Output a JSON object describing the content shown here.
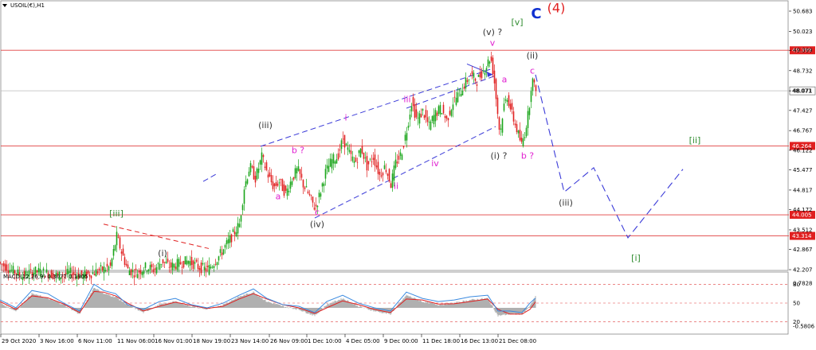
{
  "chart_data": {
    "type": "candlestick",
    "symbol_label": "USOIL(€),H1",
    "price_axis": {
      "ticks": [
        "50.683",
        "50.023",
        "49.399",
        "48.732",
        "48.071",
        "47.427",
        "46.767",
        "46.122",
        "45.477",
        "44.817",
        "44.172",
        "43.512",
        "42.867",
        "42.207"
      ],
      "ylim": [
        42.207,
        50.683
      ]
    },
    "horizontal_levels": [
      {
        "label": "49.399",
        "value": 49.399
      },
      {
        "label": "48.071",
        "value": 48.071,
        "style": "current"
      },
      {
        "label": "46.264",
        "value": 46.264
      },
      {
        "label": "44.005",
        "value": 44.005
      },
      {
        "label": "43.314",
        "value": 43.314
      }
    ],
    "price_path": [
      [
        0,
        42.45
      ],
      [
        15,
        42.2
      ],
      [
        30,
        42.0
      ],
      [
        45,
        42.15
      ],
      [
        60,
        42.1
      ],
      [
        75,
        42.0
      ],
      [
        90,
        42.1
      ],
      [
        105,
        42.0
      ],
      [
        118,
        42.1
      ],
      [
        128,
        42.2
      ],
      [
        140,
        42.3
      ],
      [
        148,
        43.3
      ],
      [
        155,
        42.7
      ],
      [
        162,
        42.2
      ],
      [
        172,
        42.1
      ],
      [
        185,
        42.3
      ],
      [
        195,
        42.2
      ],
      [
        205,
        42.5
      ],
      [
        215,
        42.3
      ],
      [
        225,
        42.4
      ],
      [
        238,
        42.5
      ],
      [
        250,
        42.3
      ],
      [
        262,
        42.2
      ],
      [
        275,
        42.6
      ],
      [
        285,
        43.0
      ],
      [
        295,
        43.4
      ],
      [
        302,
        43.7
      ],
      [
        308,
        44.9
      ],
      [
        315,
        45.6
      ],
      [
        322,
        45.2
      ],
      [
        330,
        45.9
      ],
      [
        338,
        45.3
      ],
      [
        345,
        44.9
      ],
      [
        352,
        45.1
      ],
      [
        360,
        44.7
      ],
      [
        368,
        45.2
      ],
      [
        375,
        45.5
      ],
      [
        382,
        45.0
      ],
      [
        390,
        44.6
      ],
      [
        397,
        44.2
      ],
      [
        403,
        44.7
      ],
      [
        410,
        45.4
      ],
      [
        418,
        45.8
      ],
      [
        425,
        45.9
      ],
      [
        432,
        46.5
      ],
      [
        440,
        46.0
      ],
      [
        447,
        45.7
      ],
      [
        455,
        46.2
      ],
      [
        462,
        45.6
      ],
      [
        470,
        45.9
      ],
      [
        478,
        45.3
      ],
      [
        485,
        45.6
      ],
      [
        492,
        45.0
      ],
      [
        498,
        45.7
      ],
      [
        505,
        46.0
      ],
      [
        512,
        46.8
      ],
      [
        518,
        47.7
      ],
      [
        525,
        47.1
      ],
      [
        532,
        47.4
      ],
      [
        540,
        46.9
      ],
      [
        547,
        47.3
      ],
      [
        555,
        47.5
      ],
      [
        562,
        47.1
      ],
      [
        570,
        47.7
      ],
      [
        578,
        48.0
      ],
      [
        585,
        48.3
      ],
      [
        592,
        48.6
      ],
      [
        600,
        48.4
      ],
      [
        607,
        48.7
      ],
      [
        612,
        48.9
      ],
      [
        617,
        49.2
      ],
      [
        621,
        48.6
      ],
      [
        625,
        47.6
      ],
      [
        629,
        46.6
      ],
      [
        633,
        47.5
      ],
      [
        638,
        47.9
      ],
      [
        644,
        47.3
      ],
      [
        650,
        46.8
      ],
      [
        656,
        46.3
      ],
      [
        660,
        46.7
      ],
      [
        665,
        47.4
      ],
      [
        669,
        48.5
      ],
      [
        672,
        48.2
      ]
    ],
    "elliptic": {
      "wave_labels": [
        {
          "text": "[iii]",
          "color": "#2e8b2e",
          "at": [
            146,
            43.95
          ]
        },
        {
          "text": "(i)",
          "color": "#333333",
          "at": [
            204,
            42.65
          ]
        },
        {
          "text": "(iii)",
          "color": "#333333",
          "at": [
            333,
            46.85
          ]
        },
        {
          "text": "b ?",
          "color": "#e020d0",
          "at": [
            374,
            46.03
          ]
        },
        {
          "text": "a",
          "color": "#e020d0",
          "at": [
            349,
            44.52
          ]
        },
        {
          "text": "c",
          "color": "#e020d0",
          "at": [
            398,
            44.0
          ]
        },
        {
          "text": "(iv)",
          "color": "#333333",
          "at": [
            398,
            43.6
          ]
        },
        {
          "text": "i",
          "color": "#e020d0",
          "at": [
            434,
            47.1
          ]
        },
        {
          "text": "ii",
          "color": "#e020d0",
          "at": [
            497,
            44.85
          ]
        },
        {
          "text": "iii",
          "color": "#e020d0",
          "at": [
            511,
            47.7
          ]
        },
        {
          "text": "iv",
          "color": "#e020d0",
          "at": [
            546,
            45.6
          ]
        },
        {
          "text": "v",
          "color": "#e020d0",
          "at": [
            618,
            49.55
          ]
        },
        {
          "text": "(v) ?",
          "color": "#333333",
          "at": [
            618,
            49.9
          ]
        },
        {
          "text": "[v]",
          "color": "#2e8b2e",
          "at": [
            649,
            50.23
          ]
        },
        {
          "text": "C",
          "color": "#1030d0",
          "at": [
            673,
            50.45
          ]
        },
        {
          "text": "(4)",
          "color": "#e02020",
          "at": [
            698,
            50.65
          ]
        },
        {
          "text": "(ii)",
          "color": "#333333",
          "at": [
            668,
            49.13
          ]
        },
        {
          "text": "c",
          "color": "#e020d0",
          "at": [
            668,
            48.63
          ]
        },
        {
          "text": "a",
          "color": "#e020d0",
          "at": [
            633,
            48.35
          ]
        },
        {
          "text": "(i) ?",
          "color": "#333333",
          "at": [
            626,
            45.85
          ]
        },
        {
          "text": "b ?",
          "color": "#e020d0",
          "at": [
            662,
            45.85
          ]
        },
        {
          "text": "(iii)",
          "color": "#333333",
          "at": [
            710,
            44.3
          ]
        },
        {
          "text": "[ii]",
          "color": "#2e8b2e",
          "at": [
            872,
            46.35
          ]
        },
        {
          "text": "[i]",
          "color": "#2e8b2e",
          "at": [
            798,
            42.5
          ]
        }
      ],
      "projection_path": [
        [
          672,
          48.6
        ],
        [
          708,
          44.75
        ],
        [
          745,
          45.55
        ],
        [
          788,
          43.25
        ],
        [
          857,
          45.5
        ]
      ],
      "channel_lines": [
        [
          [
            327,
            46.25
          ],
          [
            618,
            48.8
          ]
        ],
        [
          [
            395,
            43.9
          ],
          [
            622,
            46.9
          ]
        ],
        [
          [
            510,
            47.5
          ],
          [
            620,
            48.55
          ]
        ],
        [
          [
            255,
            45.1
          ],
          [
            272,
            45.35
          ]
        ]
      ],
      "red_dashed_line": [
        [
          130,
          43.7
        ],
        [
          262,
          42.9
        ]
      ],
      "small_arrow": [
        [
          586,
          48.95
        ],
        [
          618,
          48.6
        ]
      ]
    },
    "macd": {
      "label": "MACD(12,26,9) 0.3077 0.1905",
      "ticks": [
        "0.7828",
        "80",
        "50",
        "20",
        "-0.5806"
      ],
      "levels": [
        80,
        50,
        20
      ],
      "columns": [
        [
          0,
          0.15
        ],
        [
          20,
          -0.1
        ],
        [
          40,
          0.45
        ],
        [
          60,
          0.3
        ],
        [
          80,
          0.1
        ],
        [
          100,
          -0.2
        ],
        [
          118,
          0.65
        ],
        [
          130,
          0.45
        ],
        [
          145,
          0.35
        ],
        [
          160,
          0.1
        ],
        [
          180,
          -0.15
        ],
        [
          200,
          0.1
        ],
        [
          220,
          0.2
        ],
        [
          240,
          0.05
        ],
        [
          260,
          -0.05
        ],
        [
          280,
          0.1
        ],
        [
          300,
          0.35
        ],
        [
          318,
          0.5
        ],
        [
          335,
          0.2
        ],
        [
          355,
          0.05
        ],
        [
          375,
          -0.05
        ],
        [
          395,
          -0.25
        ],
        [
          410,
          0.1
        ],
        [
          430,
          0.3
        ],
        [
          450,
          0.05
        ],
        [
          470,
          -0.1
        ],
        [
          490,
          -0.2
        ],
        [
          510,
          0.4
        ],
        [
          530,
          0.2
        ],
        [
          550,
          0.1
        ],
        [
          570,
          0.15
        ],
        [
          590,
          0.25
        ],
        [
          612,
          0.3
        ],
        [
          625,
          -0.25
        ],
        [
          640,
          -0.2
        ],
        [
          655,
          -0.2
        ],
        [
          665,
          0.05
        ],
        [
          672,
          0.35
        ]
      ],
      "signal": [
        [
          0,
          0.2
        ],
        [
          20,
          -0.05
        ],
        [
          40,
          0.38
        ],
        [
          60,
          0.32
        ],
        [
          80,
          0.12
        ],
        [
          100,
          -0.15
        ],
        [
          118,
          0.52
        ],
        [
          130,
          0.5
        ],
        [
          145,
          0.38
        ],
        [
          160,
          0.15
        ],
        [
          180,
          -0.1
        ],
        [
          200,
          0.05
        ],
        [
          220,
          0.18
        ],
        [
          240,
          0.08
        ],
        [
          260,
          -0.02
        ],
        [
          280,
          0.05
        ],
        [
          300,
          0.28
        ],
        [
          318,
          0.45
        ],
        [
          335,
          0.28
        ],
        [
          355,
          0.1
        ],
        [
          375,
          0.0
        ],
        [
          395,
          -0.18
        ],
        [
          410,
          0.0
        ],
        [
          430,
          0.22
        ],
        [
          450,
          0.1
        ],
        [
          470,
          -0.05
        ],
        [
          490,
          -0.15
        ],
        [
          510,
          0.28
        ],
        [
          530,
          0.25
        ],
        [
          550,
          0.12
        ],
        [
          570,
          0.13
        ],
        [
          590,
          0.2
        ],
        [
          612,
          0.28
        ],
        [
          625,
          -0.05
        ],
        [
          640,
          -0.2
        ],
        [
          655,
          -0.2
        ],
        [
          665,
          -0.05
        ],
        [
          672,
          0.19
        ]
      ],
      "line": [
        [
          0,
          0.25
        ],
        [
          20,
          0.0
        ],
        [
          40,
          0.55
        ],
        [
          60,
          0.45
        ],
        [
          80,
          0.15
        ],
        [
          100,
          -0.1
        ],
        [
          118,
          0.75
        ],
        [
          130,
          0.55
        ],
        [
          145,
          0.45
        ],
        [
          160,
          0.1
        ],
        [
          180,
          -0.05
        ],
        [
          200,
          0.2
        ],
        [
          220,
          0.3
        ],
        [
          240,
          0.1
        ],
        [
          260,
          0.0
        ],
        [
          280,
          0.15
        ],
        [
          300,
          0.4
        ],
        [
          318,
          0.6
        ],
        [
          335,
          0.3
        ],
        [
          355,
          0.1
        ],
        [
          375,
          0.05
        ],
        [
          395,
          -0.15
        ],
        [
          410,
          0.2
        ],
        [
          430,
          0.4
        ],
        [
          450,
          0.15
        ],
        [
          470,
          0.0
        ],
        [
          490,
          -0.1
        ],
        [
          510,
          0.5
        ],
        [
          530,
          0.3
        ],
        [
          550,
          0.2
        ],
        [
          570,
          0.25
        ],
        [
          590,
          0.35
        ],
        [
          612,
          0.4
        ],
        [
          625,
          -0.1
        ],
        [
          640,
          -0.1
        ],
        [
          655,
          -0.15
        ],
        [
          665,
          0.15
        ],
        [
          672,
          0.31
        ]
      ]
    },
    "time_axis": [
      "29 Oct 2020",
      "3 Nov 16:00",
      "6 Nov 11:00",
      "11 Nov 06:00",
      "16 Nov 01:00",
      "18 Nov 19:00",
      "23 Nov 14:00",
      "26 Nov 09:00",
      "1 Dec 10:00",
      "4 Dec 05:00",
      "9 Dec 00:00",
      "11 Dec 18:00",
      "16 Dec 13:00",
      "21 Dec 08:00"
    ],
    "colors": {
      "bull": "#1aa51a",
      "bear": "#e02020",
      "level": "#e04040",
      "projection": "#3a3ad8",
      "macd_hist": "#b0b0b0",
      "macd_line": "#3a8ae0",
      "macd_signal": "#e02020"
    }
  }
}
